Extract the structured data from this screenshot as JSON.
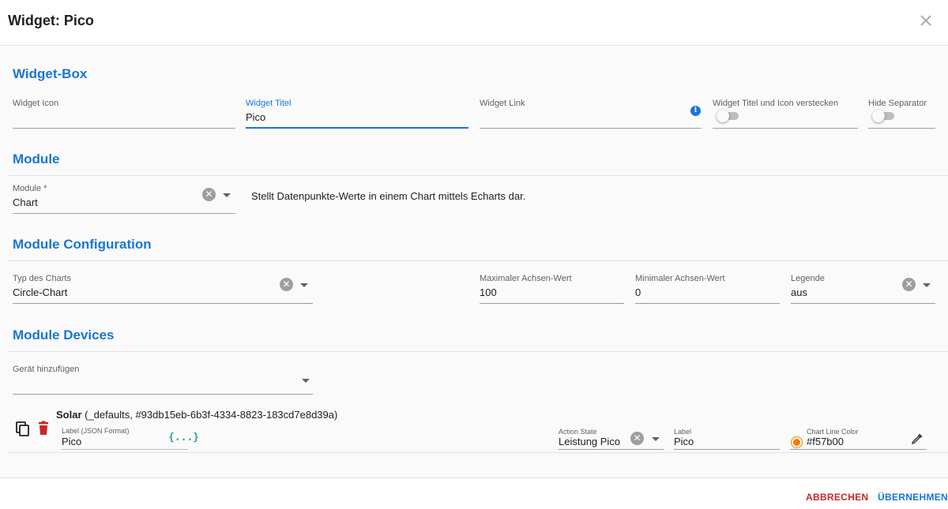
{
  "dialog": {
    "title": "Widget: Pico",
    "close_icon": "close-icon"
  },
  "widget_box": {
    "title": "Widget-Box",
    "icon_label": "Widget Icon",
    "icon_value": "",
    "title_label": "Widget Titel",
    "title_value": "Pico",
    "link_label": "Widget Link",
    "link_value": "",
    "hide_title_label": "Widget Titel und Icon verstecken",
    "hide_title_checked": false,
    "hide_separator_label": "Hide Separator",
    "hide_separator_checked": false
  },
  "module": {
    "title": "Module",
    "label": "Module *",
    "value": "Chart",
    "description": "Stellt Datenpunkte-Werte in einem Chart mittels Echarts dar."
  },
  "module_config": {
    "title": "Module Configuration",
    "chart_type_label": "Typ des Charts",
    "chart_type_value": "Circle-Chart",
    "max_axis_label": "Maximaler Achsen-Wert",
    "max_axis_value": "100",
    "min_axis_label": "Minimaler Achsen-Wert",
    "min_axis_value": "0",
    "legend_label": "Legende",
    "legend_value": "aus"
  },
  "module_devices": {
    "title": "Module Devices",
    "add_device_label": "Gerät hinzufügen",
    "add_device_value": "",
    "device": {
      "name": "Solar",
      "detail": " (_defaults, #93db15eb-6b3f-4334-8823-183cd7e8d39a)",
      "json_label_label": "Label (JSON Format)",
      "json_label_value": "Pico",
      "json_icon_glyph": "{...}",
      "action_state_label": "Action State",
      "action_state_value": "Leistung Pico",
      "label_label": "Label",
      "label_value": "Pico",
      "color_label": "Chart Line Color",
      "color_value": "#f57b00"
    }
  },
  "footer": {
    "cancel_label": "ABBRECHEN",
    "apply_label": "ÜBERNEHMEN"
  },
  "colors": {
    "accent": "#1976d2",
    "danger": "#c62828",
    "chart_line": "#f57b00",
    "json_icon": "#26a69a"
  }
}
